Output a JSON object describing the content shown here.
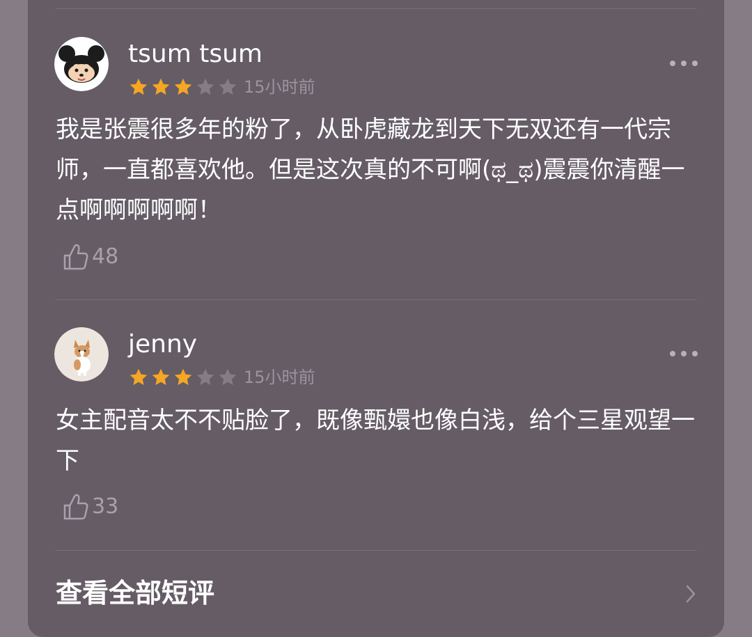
{
  "reviews": [
    {
      "username": "tsum tsum",
      "rating": 3,
      "max_rating": 5,
      "timestamp": "15小时前",
      "content": "我是张震很多年的粉了，从卧虎藏龙到天下无双还有一代宗师，一直都喜欢他。但是这次真的不可啊(ಥ_ಥ)震震你清醒一点啊啊啊啊啊！",
      "likes": "48",
      "avatar_icon": "tsum-tsum-mickey-avatar"
    },
    {
      "username": "jenny",
      "rating": 3,
      "max_rating": 5,
      "timestamp": "15小时前",
      "content": "女主配音太不不贴脸了，既像甄嬛也像白浅，给个三星观望一下",
      "likes": "33",
      "avatar_icon": "corgi-avatar"
    }
  ],
  "footer": {
    "view_all_label": "查看全部短评"
  },
  "colors": {
    "star_filled": "#f5a623",
    "star_empty": "#857c86",
    "card_background": "#655c66",
    "page_background": "#857c86"
  },
  "icons": {
    "more": "more-dots-icon",
    "like": "thumbs-up-icon",
    "chevron": "chevron-right-icon"
  }
}
